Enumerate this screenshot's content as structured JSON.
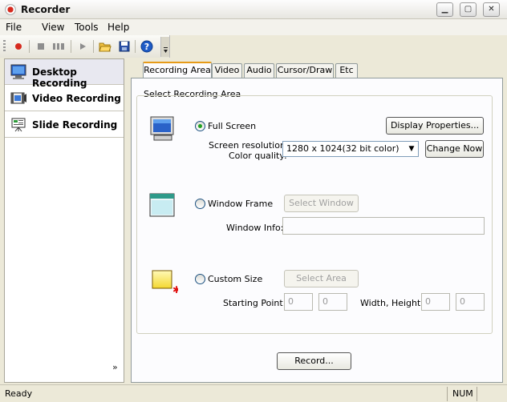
{
  "window": {
    "title": "Recorder",
    "icon": "record-icon"
  },
  "menu": {
    "items": [
      "File",
      "View",
      "Tools",
      "Help"
    ]
  },
  "toolbar": {
    "icons": [
      "record-icon",
      "stop-icon",
      "pause-icon",
      "play-icon",
      "open-folder-icon",
      "save-icon",
      "help-icon"
    ]
  },
  "nav": {
    "items": [
      {
        "label": "Desktop Recording",
        "icon": "desktop-monitor-icon"
      },
      {
        "label": "Video Recording",
        "icon": "film-icon"
      },
      {
        "label": "Slide Recording",
        "icon": "presentation-icon"
      }
    ],
    "more": "»"
  },
  "tabs": [
    "Recording Area",
    "Video",
    "Audio",
    "Cursor/Draw",
    "Etc"
  ],
  "panel": {
    "group_title": "Select Recording Area",
    "full_screen": {
      "label": "Full Screen",
      "checked": true,
      "display_button": "Display Properties...",
      "resolution_label_1": "Screen resolution,",
      "resolution_label_2": "Color quality:",
      "resolution_value": "1280 x 1024(32 bit color)",
      "change_button": "Change Now"
    },
    "window_frame": {
      "label": "Window Frame",
      "select_button": "Select Window",
      "info_label": "Window Info:",
      "info_value": ""
    },
    "custom_size": {
      "label": "Custom Size",
      "select_button": "Select Area",
      "start_label": "Starting Point:",
      "start_x": "0",
      "start_y": "0",
      "size_label": "Width, Height:",
      "width": "0",
      "height": "0"
    },
    "record_button": "Record..."
  },
  "status": {
    "text": "Ready",
    "num": "NUM"
  },
  "colors": {
    "accent_tab": "#e69b19",
    "radio_dot": "#21a121",
    "record_red": "#d62a1e"
  }
}
